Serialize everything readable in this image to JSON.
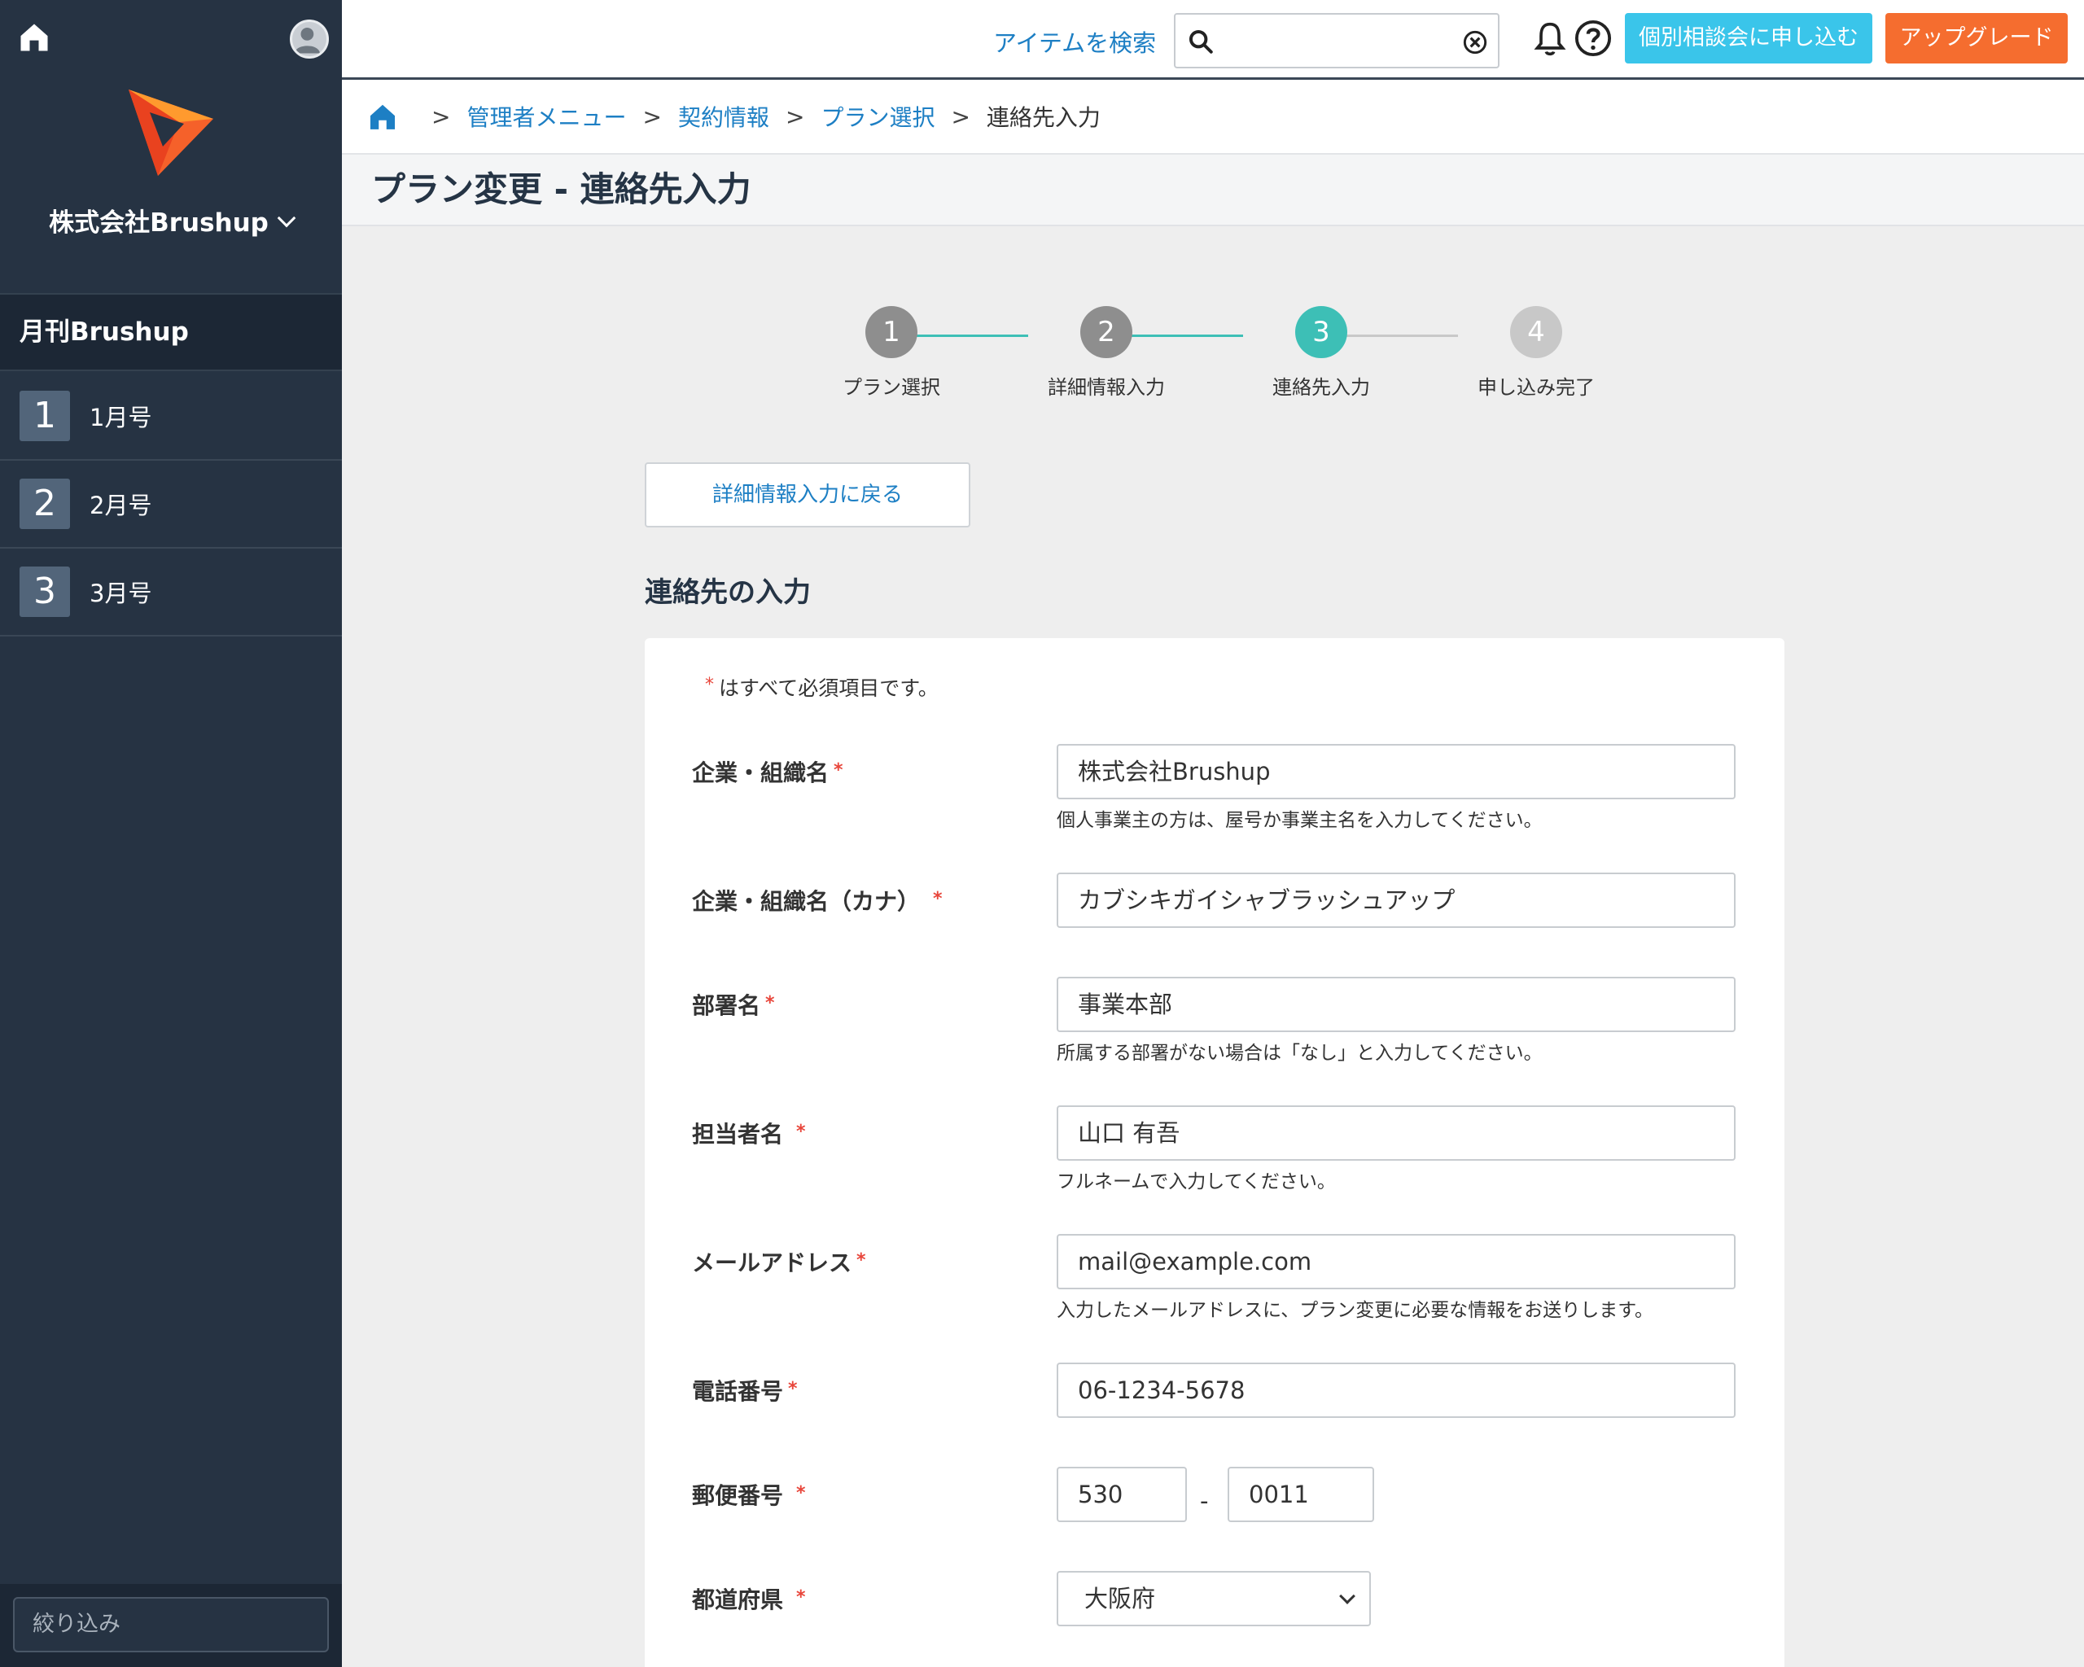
{
  "sidebar": {
    "company": "株式会社Brushup",
    "section_title": "月刊Brushup",
    "items": [
      {
        "num": "1",
        "label": "1月号"
      },
      {
        "num": "2",
        "label": "2月号"
      },
      {
        "num": "3",
        "label": "3月号"
      }
    ],
    "filter_placeholder": "絞り込み"
  },
  "topbar": {
    "search_label": "アイテムを検索",
    "search_value": "",
    "consult_button": "個別相談会に申し込む",
    "upgrade_button": "アップグレード"
  },
  "breadcrumb": {
    "items": [
      "管理者メニュー",
      "契約情報",
      "プラン選択"
    ],
    "current": "連絡先入力",
    "separator": ">"
  },
  "page": {
    "title": "プラン変更 - 連絡先入力",
    "back_button": "詳細情報入力に戻る",
    "section_title": "連絡先の入力",
    "required_note": "はすべて必須項目です。"
  },
  "stepper": {
    "steps": [
      {
        "num": "1",
        "label": "プラン選択",
        "state": "done"
      },
      {
        "num": "2",
        "label": "詳細情報入力",
        "state": "done"
      },
      {
        "num": "3",
        "label": "連絡先入力",
        "state": "current"
      },
      {
        "num": "4",
        "label": "申し込み完了",
        "state": "pending"
      }
    ]
  },
  "form": {
    "company_name": {
      "label": "企業・組織名",
      "value": "株式会社Brushup",
      "hint": "個人事業主の方は、屋号か事業主名を入力してください。"
    },
    "company_kana": {
      "label": "企業・組織名（カナ）",
      "value": "カブシキガイシャブラッシュアップ"
    },
    "department": {
      "label": "部署名",
      "value": "事業本部",
      "hint": "所属する部署がない場合は「なし」と入力してください。"
    },
    "person": {
      "label": "担当者名",
      "value": "山口 有吾",
      "hint": "フルネームで入力してください。"
    },
    "email": {
      "label": "メールアドレス",
      "value": "mail@example.com",
      "hint": "入力したメールアドレスに、プラン変更に必要な情報をお送りします。"
    },
    "phone": {
      "label": "電話番号",
      "value": "06-1234-5678"
    },
    "zip": {
      "label": "郵便番号",
      "value1": "530",
      "value2": "0011",
      "dash": "-"
    },
    "prefecture": {
      "label": "都道府県",
      "value": "大阪府"
    }
  },
  "required_mark": "*",
  "colors": {
    "sidebar_bg": "#263343",
    "accent_teal": "#3dbfb6",
    "step_done": "#8e8e8e",
    "step_pending": "#c8c8c8",
    "link_blue": "#1d7fc4",
    "consult_bg": "#3ac5ea",
    "upgrade_bg": "#f56d2f",
    "required_red": "#e8463b"
  }
}
